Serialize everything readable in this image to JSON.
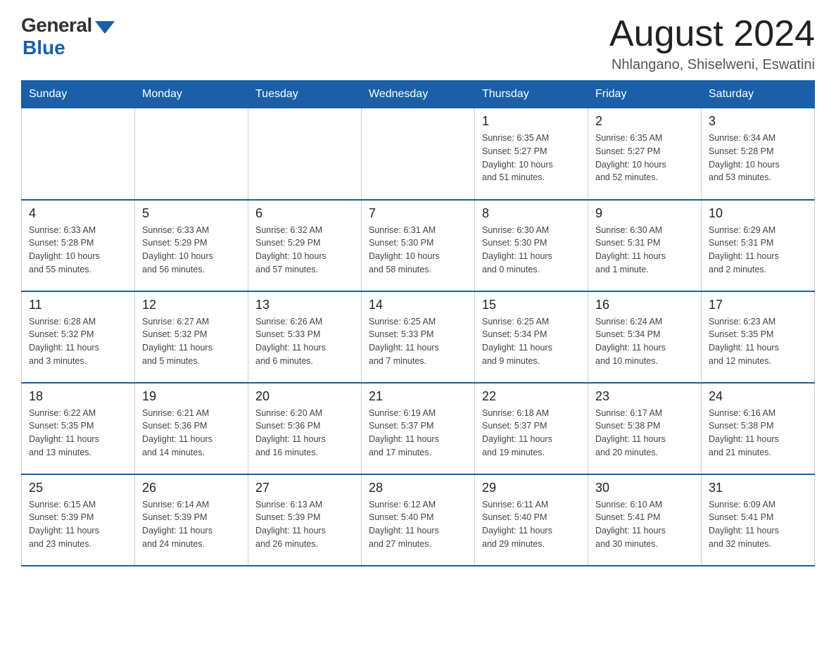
{
  "logo": {
    "general": "General",
    "blue": "Blue"
  },
  "title": "August 2024",
  "location": "Nhlangano, Shiselweni, Eswatini",
  "days_of_week": [
    "Sunday",
    "Monday",
    "Tuesday",
    "Wednesday",
    "Thursday",
    "Friday",
    "Saturday"
  ],
  "weeks": [
    [
      {
        "day": "",
        "info": ""
      },
      {
        "day": "",
        "info": ""
      },
      {
        "day": "",
        "info": ""
      },
      {
        "day": "",
        "info": ""
      },
      {
        "day": "1",
        "info": "Sunrise: 6:35 AM\nSunset: 5:27 PM\nDaylight: 10 hours\nand 51 minutes."
      },
      {
        "day": "2",
        "info": "Sunrise: 6:35 AM\nSunset: 5:27 PM\nDaylight: 10 hours\nand 52 minutes."
      },
      {
        "day": "3",
        "info": "Sunrise: 6:34 AM\nSunset: 5:28 PM\nDaylight: 10 hours\nand 53 minutes."
      }
    ],
    [
      {
        "day": "4",
        "info": "Sunrise: 6:33 AM\nSunset: 5:28 PM\nDaylight: 10 hours\nand 55 minutes."
      },
      {
        "day": "5",
        "info": "Sunrise: 6:33 AM\nSunset: 5:29 PM\nDaylight: 10 hours\nand 56 minutes."
      },
      {
        "day": "6",
        "info": "Sunrise: 6:32 AM\nSunset: 5:29 PM\nDaylight: 10 hours\nand 57 minutes."
      },
      {
        "day": "7",
        "info": "Sunrise: 6:31 AM\nSunset: 5:30 PM\nDaylight: 10 hours\nand 58 minutes."
      },
      {
        "day": "8",
        "info": "Sunrise: 6:30 AM\nSunset: 5:30 PM\nDaylight: 11 hours\nand 0 minutes."
      },
      {
        "day": "9",
        "info": "Sunrise: 6:30 AM\nSunset: 5:31 PM\nDaylight: 11 hours\nand 1 minute."
      },
      {
        "day": "10",
        "info": "Sunrise: 6:29 AM\nSunset: 5:31 PM\nDaylight: 11 hours\nand 2 minutes."
      }
    ],
    [
      {
        "day": "11",
        "info": "Sunrise: 6:28 AM\nSunset: 5:32 PM\nDaylight: 11 hours\nand 3 minutes."
      },
      {
        "day": "12",
        "info": "Sunrise: 6:27 AM\nSunset: 5:32 PM\nDaylight: 11 hours\nand 5 minutes."
      },
      {
        "day": "13",
        "info": "Sunrise: 6:26 AM\nSunset: 5:33 PM\nDaylight: 11 hours\nand 6 minutes."
      },
      {
        "day": "14",
        "info": "Sunrise: 6:25 AM\nSunset: 5:33 PM\nDaylight: 11 hours\nand 7 minutes."
      },
      {
        "day": "15",
        "info": "Sunrise: 6:25 AM\nSunset: 5:34 PM\nDaylight: 11 hours\nand 9 minutes."
      },
      {
        "day": "16",
        "info": "Sunrise: 6:24 AM\nSunset: 5:34 PM\nDaylight: 11 hours\nand 10 minutes."
      },
      {
        "day": "17",
        "info": "Sunrise: 6:23 AM\nSunset: 5:35 PM\nDaylight: 11 hours\nand 12 minutes."
      }
    ],
    [
      {
        "day": "18",
        "info": "Sunrise: 6:22 AM\nSunset: 5:35 PM\nDaylight: 11 hours\nand 13 minutes."
      },
      {
        "day": "19",
        "info": "Sunrise: 6:21 AM\nSunset: 5:36 PM\nDaylight: 11 hours\nand 14 minutes."
      },
      {
        "day": "20",
        "info": "Sunrise: 6:20 AM\nSunset: 5:36 PM\nDaylight: 11 hours\nand 16 minutes."
      },
      {
        "day": "21",
        "info": "Sunrise: 6:19 AM\nSunset: 5:37 PM\nDaylight: 11 hours\nand 17 minutes."
      },
      {
        "day": "22",
        "info": "Sunrise: 6:18 AM\nSunset: 5:37 PM\nDaylight: 11 hours\nand 19 minutes."
      },
      {
        "day": "23",
        "info": "Sunrise: 6:17 AM\nSunset: 5:38 PM\nDaylight: 11 hours\nand 20 minutes."
      },
      {
        "day": "24",
        "info": "Sunrise: 6:16 AM\nSunset: 5:38 PM\nDaylight: 11 hours\nand 21 minutes."
      }
    ],
    [
      {
        "day": "25",
        "info": "Sunrise: 6:15 AM\nSunset: 5:39 PM\nDaylight: 11 hours\nand 23 minutes."
      },
      {
        "day": "26",
        "info": "Sunrise: 6:14 AM\nSunset: 5:39 PM\nDaylight: 11 hours\nand 24 minutes."
      },
      {
        "day": "27",
        "info": "Sunrise: 6:13 AM\nSunset: 5:39 PM\nDaylight: 11 hours\nand 26 minutes."
      },
      {
        "day": "28",
        "info": "Sunrise: 6:12 AM\nSunset: 5:40 PM\nDaylight: 11 hours\nand 27 minutes."
      },
      {
        "day": "29",
        "info": "Sunrise: 6:11 AM\nSunset: 5:40 PM\nDaylight: 11 hours\nand 29 minutes."
      },
      {
        "day": "30",
        "info": "Sunrise: 6:10 AM\nSunset: 5:41 PM\nDaylight: 11 hours\nand 30 minutes."
      },
      {
        "day": "31",
        "info": "Sunrise: 6:09 AM\nSunset: 5:41 PM\nDaylight: 11 hours\nand 32 minutes."
      }
    ]
  ]
}
